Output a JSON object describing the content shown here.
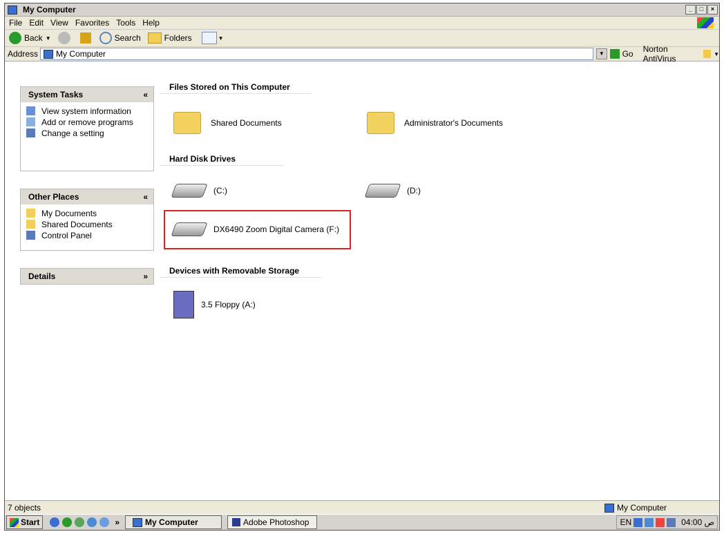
{
  "window": {
    "title": "My Computer",
    "buttons": [
      "_",
      "□",
      "×"
    ]
  },
  "menu": [
    "File",
    "Edit",
    "View",
    "Favorites",
    "Tools",
    "Help"
  ],
  "toolbar": {
    "back": "Back",
    "search": "Search",
    "folders": "Folders"
  },
  "address": {
    "label": "Address",
    "value": "My Computer",
    "go": "Go",
    "norton": "Norton AntiVirus"
  },
  "sidebar": {
    "system_tasks": {
      "title": "System Tasks",
      "toggle": "«",
      "items": [
        "View system information",
        "Add or remove programs",
        "Change a setting"
      ]
    },
    "other_places": {
      "title": "Other Places",
      "toggle": "«",
      "items": [
        "My Documents",
        "Shared Documents",
        "Control Panel"
      ]
    },
    "details": {
      "title": "Details",
      "toggle": "»"
    }
  },
  "content": {
    "files_header": "Files Stored on This Computer",
    "shared_docs": "Shared Documents",
    "admin_docs": "Administrator's Documents",
    "hdd_header": "Hard Disk Drives",
    "drive_c": "(C:)",
    "drive_d": "(D:)",
    "camera": "DX6490 Zoom Digital Camera (F:)",
    "removable_header": "Devices with Removable Storage",
    "floppy": "3.5 Floppy (A:)"
  },
  "status": {
    "count": "7 objects",
    "location": "My Computer"
  },
  "taskbar": {
    "start": "Start",
    "task1": "My Computer",
    "task2": "Adobe Photoshop",
    "chevron": "»",
    "lang": "EN",
    "clock": "04:00 ص"
  },
  "colors": {
    "highlight": "#dd2222",
    "panel_header": "#dedbd2",
    "bar": "#ece9d8"
  }
}
